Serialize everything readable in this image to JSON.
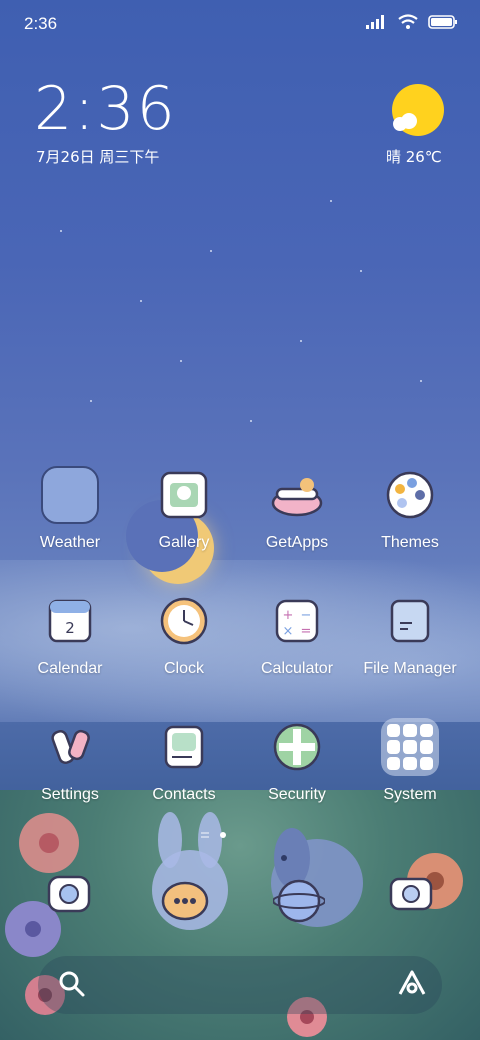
{
  "status_bar": {
    "time": "2:36",
    "icons": [
      "signal-icon",
      "wifi-icon",
      "battery-icon"
    ]
  },
  "clock_widget": {
    "time": "2:36",
    "date": "7月26日 周三下午"
  },
  "weather_widget": {
    "icon": "sun-cloud-icon",
    "text": "晴 26℃"
  },
  "apps": [
    {
      "label": "Weather",
      "icon": "weather-icon"
    },
    {
      "label": "Gallery",
      "icon": "gallery-icon"
    },
    {
      "label": "GetApps",
      "icon": "getapps-icon"
    },
    {
      "label": "Themes",
      "icon": "themes-icon"
    },
    {
      "label": "Calendar",
      "icon": "calendar-icon",
      "icon_text": "2"
    },
    {
      "label": "Clock",
      "icon": "clock-icon"
    },
    {
      "label": "Calculator",
      "icon": "calculator-icon"
    },
    {
      "label": "File Manager",
      "icon": "file-manager-icon"
    },
    {
      "label": "Settings",
      "icon": "settings-icon"
    },
    {
      "label": "Contacts",
      "icon": "contacts-icon"
    },
    {
      "label": "Security",
      "icon": "security-icon"
    },
    {
      "label": "System",
      "icon": "system-folder-icon"
    }
  ],
  "page_indicator": {
    "pages": 2,
    "active": 2
  },
  "dock": [
    {
      "icon": "phone-icon"
    },
    {
      "icon": "messages-icon"
    },
    {
      "icon": "browser-icon"
    },
    {
      "icon": "camera-icon"
    }
  ],
  "search_bar": {
    "left_icon": "search-icon",
    "right_icon": "assistant-icon"
  },
  "colors": {
    "accent_sun": "#ffd21e",
    "sky": "#4a66b6"
  }
}
